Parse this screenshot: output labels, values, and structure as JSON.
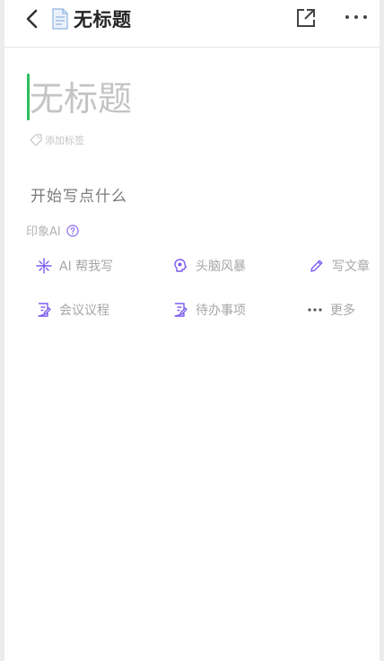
{
  "header": {
    "title": "无标题"
  },
  "editor": {
    "title_placeholder": "无标题",
    "add_tag": "添加标签",
    "start_prompt": "开始写点什么"
  },
  "ai": {
    "label": "印象AI",
    "actions": [
      {
        "label": "AI 帮我写",
        "icon": "ai-sparkle-icon"
      },
      {
        "label": "头脑风暴",
        "icon": "brain-icon"
      },
      {
        "label": "写文章",
        "icon": "pencil-icon"
      },
      {
        "label": "会议议程",
        "icon": "doc-edit-icon"
      },
      {
        "label": "待办事项",
        "icon": "doc-edit-icon"
      },
      {
        "label": "更多",
        "icon": "more-dots-icon"
      }
    ]
  },
  "colors": {
    "accent_caret": "#2dbe60",
    "ai_icon": "#7b5cf0"
  }
}
